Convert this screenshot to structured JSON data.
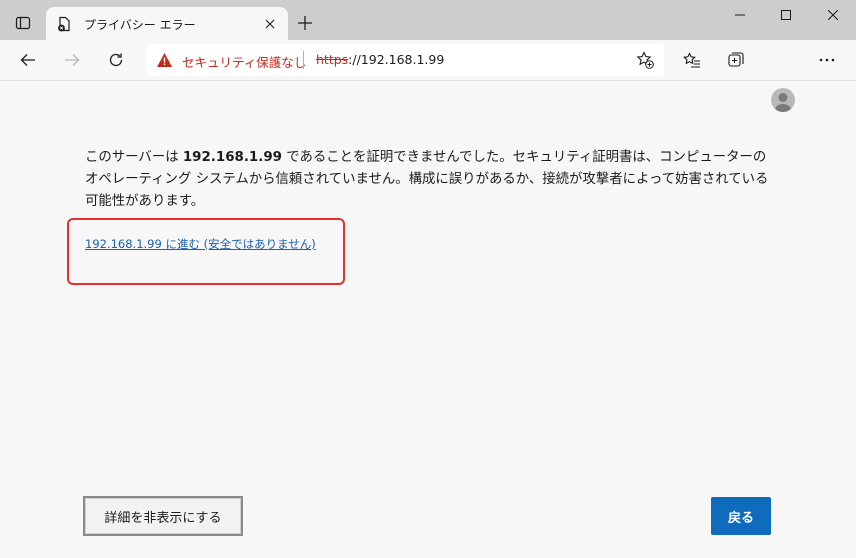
{
  "tab": {
    "title": "プライバシー エラー"
  },
  "address_bar": {
    "security_label": "セキュリティ保護なし",
    "url_scheme": "https",
    "url_rest": "://192.168.1.99"
  },
  "message": {
    "part1": "このサーバーは ",
    "host": "192.168.1.99",
    "part2": " であることを証明できませんでした。セキュリティ証明書は、コンピューターのオペレーティング システムから信頼されていません。構成に誤りがあるか、接続が攻撃者によって妨害されている可能性があります。"
  },
  "proceed_link": "192.168.1.99 に進む (安全ではありません)",
  "buttons": {
    "hide_details": "詳細を非表示にする",
    "back": "戻る"
  },
  "colors": {
    "warning_red": "#c42b1c",
    "link_blue": "#1a61b0",
    "primary_button": "#0f6cbd",
    "highlight_box": "#e0332e"
  }
}
